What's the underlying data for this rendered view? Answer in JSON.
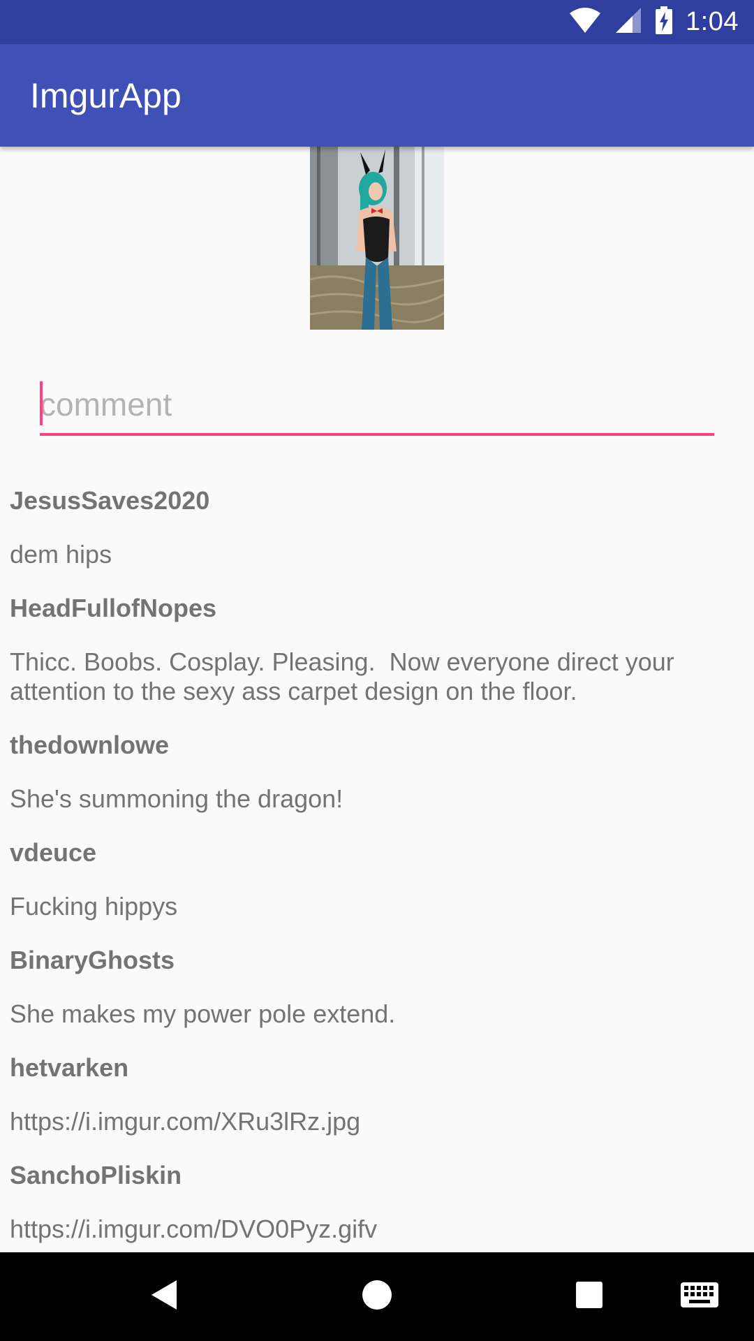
{
  "status_bar": {
    "time": "1:04",
    "icons": [
      "wifi-icon",
      "cell-signal-icon",
      "battery-charging-icon"
    ]
  },
  "app_bar": {
    "title": "ImgurApp"
  },
  "post": {
    "image_icon": "cosplay-photo"
  },
  "comment_input": {
    "placeholder": "comment",
    "value": ""
  },
  "comments": [
    {
      "user": "JesusSaves2020",
      "text": "dem hips"
    },
    {
      "user": "HeadFullofNopes",
      "text": "Thicc. Boobs. Cosplay. Pleasing.  Now everyone direct your attention to the sexy ass carpet design on the floor."
    },
    {
      "user": "thedownlowe",
      "text": "She's summoning the dragon!"
    },
    {
      "user": "vdeuce",
      "text": "Fucking hippys"
    },
    {
      "user": "BinaryGhosts",
      "text": "She makes my power pole extend."
    },
    {
      "user": "hetvarken",
      "text": "https://i.imgur.com/XRu3lRz.jpg"
    },
    {
      "user": "SanchoPliskin",
      "text": "https://i.imgur.com/DVO0Pyz.gifv"
    }
  ],
  "nav_bar": {
    "buttons": [
      "back-icon",
      "home-icon",
      "recents-icon",
      "keyboard-icon"
    ]
  },
  "colors": {
    "status_bar": "#303f9f",
    "app_bar": "#3f51b5",
    "accent": "#ff4081",
    "text": "#737373",
    "background": "#fafafa"
  }
}
